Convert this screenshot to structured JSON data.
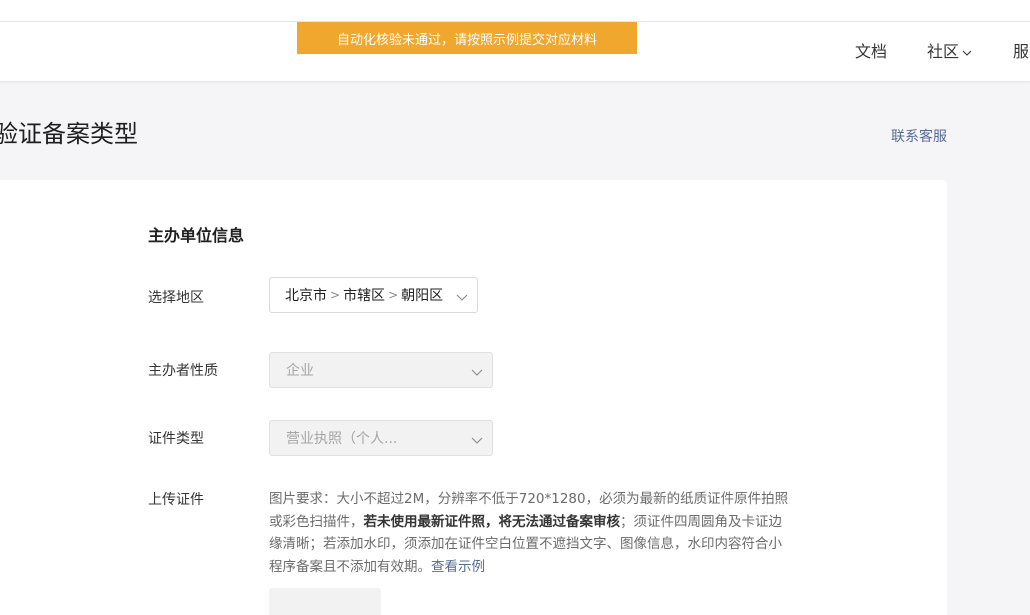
{
  "banner": {
    "text": "自动化核验未通过，请按照示例提交对应材料"
  },
  "nav": {
    "docs": "文档",
    "community": "社区",
    "service": "服"
  },
  "page": {
    "title": "验证备案类型",
    "contact": "联系客服"
  },
  "form": {
    "section_title": "主办单位信息",
    "region": {
      "label": "选择地区",
      "province": "北京市",
      "city": "市辖区",
      "district": "朝阳区"
    },
    "nature": {
      "label": "主办者性质",
      "value": "企业"
    },
    "id_type": {
      "label": "证件类型",
      "value": "营业执照（个人..."
    },
    "upload": {
      "label": "上传证件",
      "desc_part1": "图片要求：大小不超过2M，分辨率不低于720*1280，必须为最新的纸质证件原件拍照或彩色扫描件，",
      "desc_bold": "若未使用最新证件照，将无法通过备案审核",
      "desc_part2": "；须证件四周圆角及卡证边缘清晰；若添加水印，须添加在证件空白位置不遮挡文字、图像信息，水印内容符合小程序备案且不添加有效期。",
      "example_link": "查看示例"
    }
  },
  "colors": {
    "banner": "#f0a72e",
    "link": "#576b95",
    "background": "#f5f5f7"
  }
}
